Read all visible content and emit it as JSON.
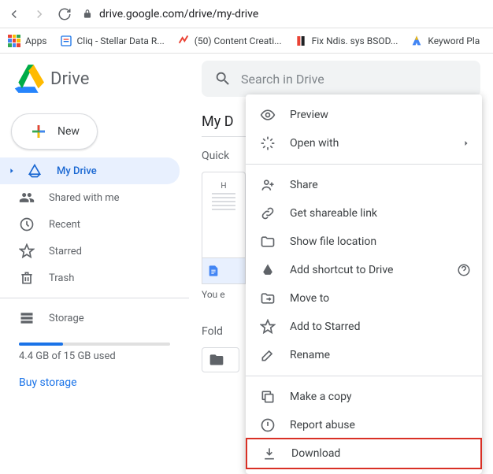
{
  "browser": {
    "url": "drive.google.com/drive/my-drive",
    "bookmarks": [
      {
        "label": "Apps"
      },
      {
        "label": "Cliq - Stellar Data R..."
      },
      {
        "label": "(50) Content Creati..."
      },
      {
        "label": "Fix Ndis. sys BSOD..."
      },
      {
        "label": "Keyword Pla"
      }
    ]
  },
  "header": {
    "title": "Drive",
    "search_placeholder": "Search in Drive"
  },
  "sidebar": {
    "new_label": "New",
    "items": [
      {
        "label": "My Drive"
      },
      {
        "label": "Shared with me"
      },
      {
        "label": "Recent"
      },
      {
        "label": "Starred"
      },
      {
        "label": "Trash"
      }
    ],
    "storage": {
      "title": "Storage",
      "usage_text": "4.4 GB of 15 GB used",
      "percent": 29,
      "buy_label": "Buy storage"
    }
  },
  "content": {
    "title": "My D",
    "quick_label": "Quick",
    "thumb_text": "H",
    "file_footer": "",
    "file_sub": "You e",
    "folders_label": "Fold"
  },
  "menu": {
    "items": [
      {
        "label": "Preview"
      },
      {
        "label": "Open with"
      },
      {
        "label": "Share"
      },
      {
        "label": "Get shareable link"
      },
      {
        "label": "Show file location"
      },
      {
        "label": "Add shortcut to Drive"
      },
      {
        "label": "Move to"
      },
      {
        "label": "Add to Starred"
      },
      {
        "label": "Rename"
      },
      {
        "label": "Make a copy"
      },
      {
        "label": "Report abuse"
      },
      {
        "label": "Download"
      }
    ]
  }
}
